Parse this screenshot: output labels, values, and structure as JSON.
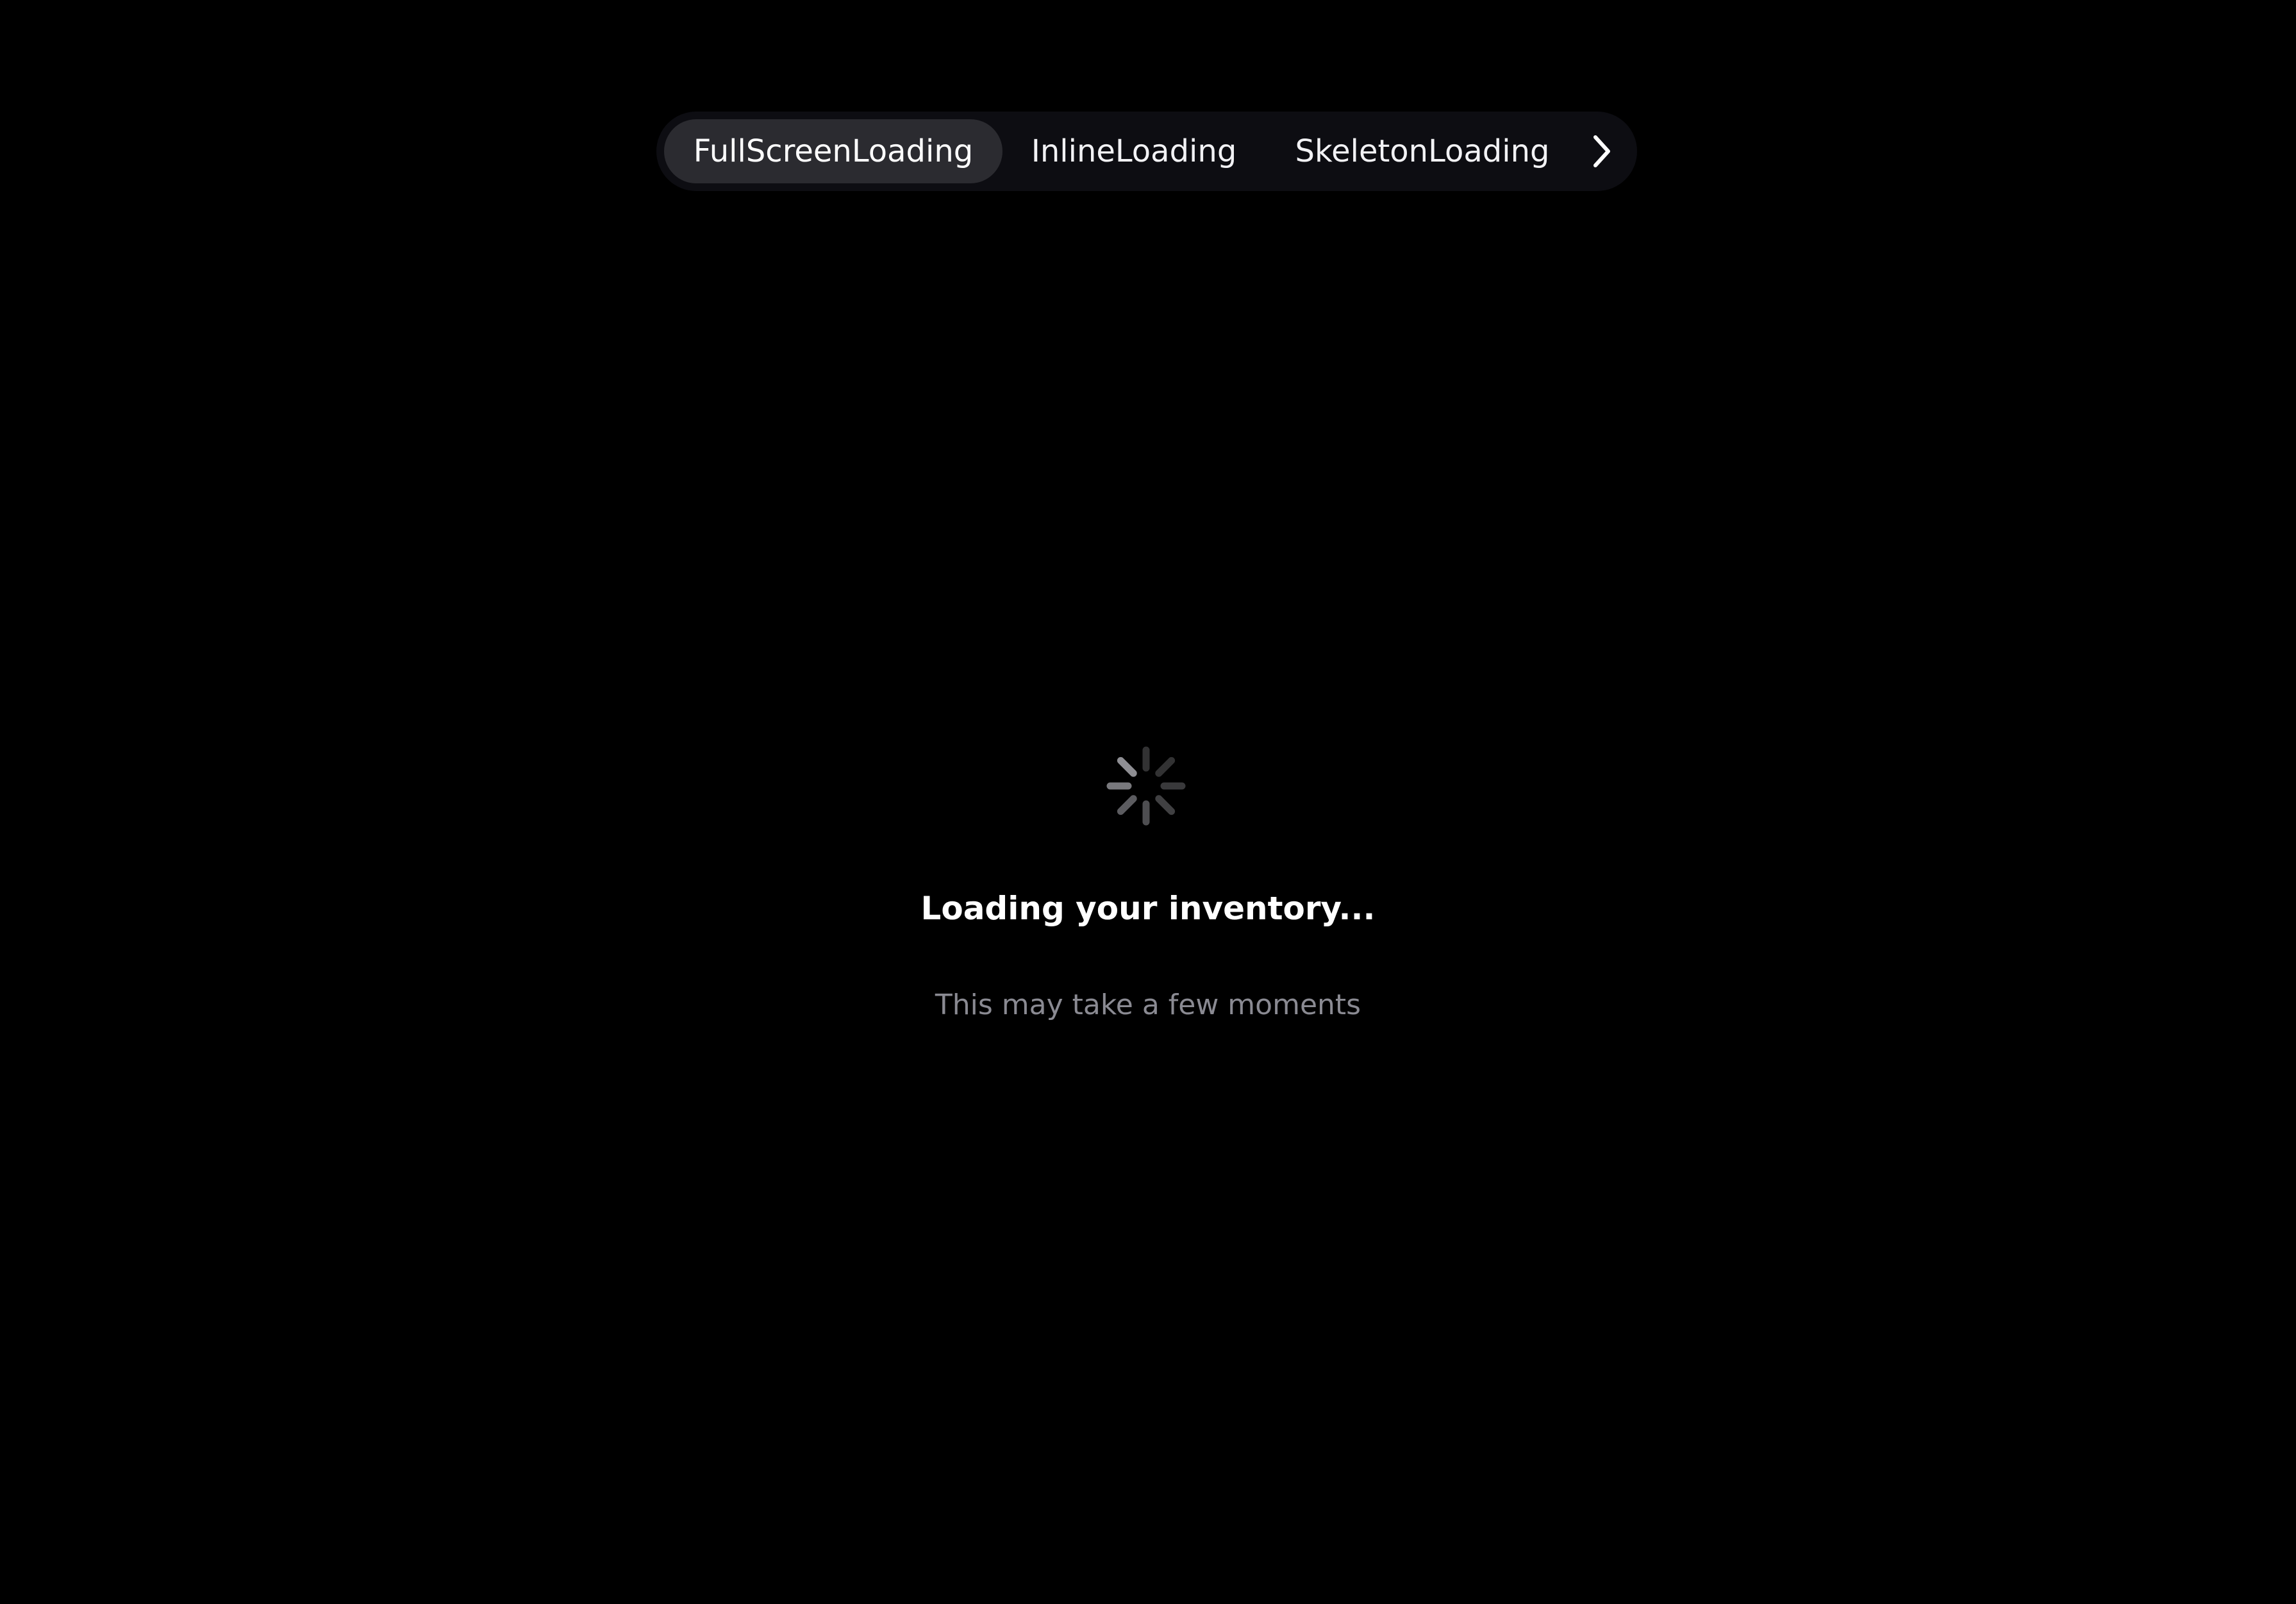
{
  "tabs": [
    {
      "label": "FullScreenLoading",
      "active": true
    },
    {
      "label": "InlineLoading",
      "active": false
    },
    {
      "label": "SkeletonLoading",
      "active": false
    }
  ],
  "icons": {
    "next": "chevron-right-icon",
    "spinner": "activity-spinner-icon"
  },
  "loading": {
    "title": "Loading your inventory...",
    "subtitle": "This may take a few moments"
  },
  "colors": {
    "background": "#000000",
    "tabbar_bg": "#0d0d12",
    "active_tab_bg": "#2b2b30",
    "subtitle": "#8a8a92",
    "spinner": "#8e8e93"
  }
}
